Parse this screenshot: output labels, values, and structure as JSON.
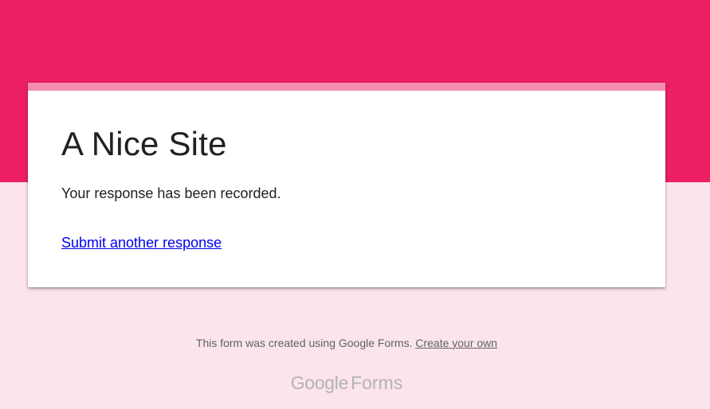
{
  "form": {
    "title": "A Nice Site",
    "confirmation_message": "Your response has been recorded.",
    "submit_another_link": "Submit another response"
  },
  "footer": {
    "created_text": "This form was created using Google Forms.",
    "create_own_link": "Create your own",
    "brand_google": "Google",
    "brand_forms": "Forms"
  },
  "colors": {
    "header": "#ec2062",
    "background": "#fce4ec",
    "card_accent": "#f48fb1",
    "link": "#0000ee"
  }
}
